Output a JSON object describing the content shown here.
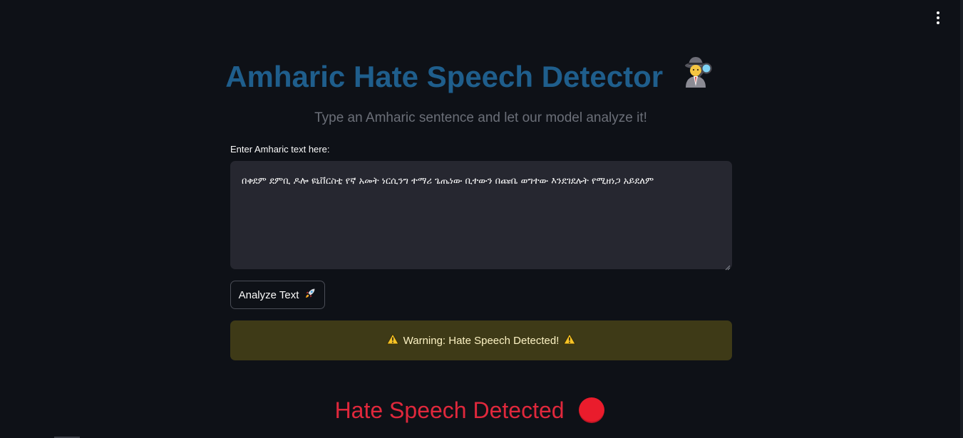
{
  "header": {
    "menu_icon": "kebab-menu-icon"
  },
  "main": {
    "title": "Amharic Hate Speech Detector",
    "title_icon": "detective-emoji-icon",
    "subtitle": "Type an Amharic sentence and let our model analyze it!",
    "input": {
      "label": "Enter Amharic text here:",
      "value": "በቀደም ደምቢ ዶሎ ዩኒቨርስቲ የኛ አመት ነርሲንግ ተማሪ ጌጤነው ቢተውን በጩቤ ወግተው እንደገደሉት የሚዘነጋ አይደለም"
    },
    "analyze_button": {
      "label": "Analyze Text",
      "icon": "rocket-icon"
    },
    "warning": {
      "text": "Warning: Hate Speech Detected!",
      "icon": "warning-icon"
    },
    "result": {
      "text": "Hate Speech Detected",
      "icon": "red-circle-icon"
    }
  },
  "colors": {
    "background": "#0e1117",
    "title": "#1f5e8c",
    "input_background": "#262730",
    "warning_background": "#3e3a17",
    "warning_text": "#fdf3c4",
    "result": "#e0283c"
  }
}
